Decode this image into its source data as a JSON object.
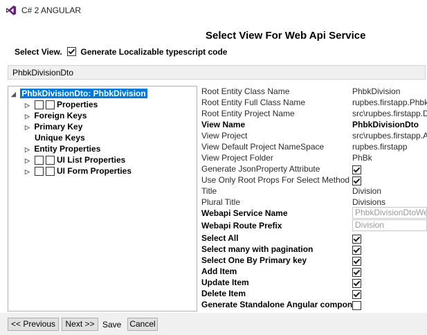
{
  "window": {
    "title": "C# 2 ANGULAR"
  },
  "heading": "Select View For Web Api Service",
  "select_view": {
    "label": "Select View.",
    "localizable_label": "Generate Localizable typescript code",
    "localizable_checked": true
  },
  "view_name": "PhbkDivisionDto",
  "tree": {
    "root": "PhbkDivisionDto: PhbkDivision",
    "items": [
      {
        "label": "Properties",
        "expander": true,
        "checkboxes": 2
      },
      {
        "label": "Foreign Keys",
        "expander": true,
        "checkboxes": 0
      },
      {
        "label": "Primary Key",
        "expander": true,
        "checkboxes": 0
      },
      {
        "label": "Unique Keys",
        "expander": false,
        "checkboxes": 0
      },
      {
        "label": "Entity Properties",
        "expander": true,
        "checkboxes": 0
      },
      {
        "label": "UI List Properties",
        "expander": true,
        "checkboxes": 2
      },
      {
        "label": "UI Form Properties",
        "expander": true,
        "checkboxes": 2
      }
    ]
  },
  "properties": [
    {
      "label": "Root Entity Class Name",
      "value": "PhbkDivision",
      "type": "text",
      "bold": false
    },
    {
      "label": "Root Entity Full Class Name",
      "value": "rupbes.firstapp.Phbk",
      "type": "text",
      "bold": false
    },
    {
      "label": "Root Entity Project Name",
      "value": "src\\rupbes.firstapp.D",
      "type": "text",
      "bold": false
    },
    {
      "label": "View Name",
      "value": "PhbkDivisionDto",
      "type": "text",
      "bold": true
    },
    {
      "label": "View Project",
      "value": "src\\rupbes.firstapp.A",
      "type": "text",
      "bold": false
    },
    {
      "label": "View Default Project NameSpace",
      "value": "rupbes.firstapp",
      "type": "text",
      "bold": false
    },
    {
      "label": "View Project Folder",
      "value": "PhBk",
      "type": "text",
      "bold": false
    },
    {
      "label": "Generate JsonProperty Attribute",
      "value": true,
      "type": "check",
      "bold": false
    },
    {
      "label": "Use Only Root Props For Select Method",
      "value": true,
      "type": "check",
      "bold": false
    },
    {
      "label": "Title",
      "value": "Division",
      "type": "text",
      "bold": false
    },
    {
      "label": "Plural Title",
      "value": "Divisions",
      "type": "text",
      "bold": false
    },
    {
      "label": "Webapi Service Name",
      "value": "PhbkDivisionDtoWe",
      "type": "input",
      "bold": true
    },
    {
      "label": "Webapi Route Prefix",
      "value": "Division",
      "type": "input",
      "bold": true
    },
    {
      "label": "Select All",
      "value": true,
      "type": "check",
      "bold": true
    },
    {
      "label": "Select many with pagination",
      "value": true,
      "type": "check",
      "bold": true
    },
    {
      "label": "Select One By Primary key",
      "value": true,
      "type": "check",
      "bold": true
    },
    {
      "label": "Add Item",
      "value": true,
      "type": "check",
      "bold": true
    },
    {
      "label": "Update Item",
      "value": true,
      "type": "check",
      "bold": true
    },
    {
      "label": "Delete Item",
      "value": true,
      "type": "check",
      "bold": true
    },
    {
      "label": "Generate Standalone Angular compone",
      "value": false,
      "type": "check",
      "bold": true
    }
  ],
  "buttons": {
    "previous": "<< Previous",
    "next": "Next >>",
    "save": "Save",
    "cancel": "Cancel"
  },
  "colors": {
    "selection": "#0078d7",
    "vs_purple": "#68217a"
  }
}
